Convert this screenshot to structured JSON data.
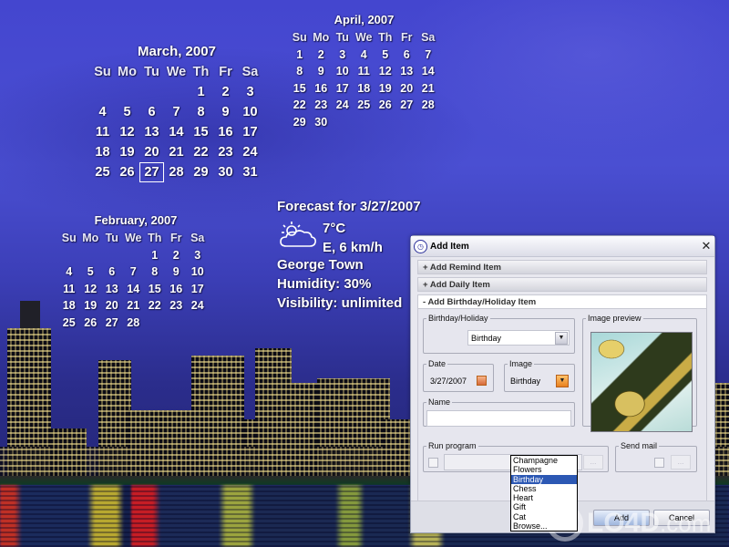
{
  "calendars": {
    "weekdays": [
      "Su",
      "Mo",
      "Tu",
      "We",
      "Th",
      "Fr",
      "Sa"
    ],
    "march": {
      "title": "March, 2007",
      "today": "27",
      "weeks": [
        [
          "",
          "",
          "",
          "",
          "1",
          "2",
          "3"
        ],
        [
          "4",
          "5",
          "6",
          "7",
          "8",
          "9",
          "10"
        ],
        [
          "11",
          "12",
          "13",
          "14",
          "15",
          "16",
          "17"
        ],
        [
          "18",
          "19",
          "20",
          "21",
          "22",
          "23",
          "24"
        ],
        [
          "25",
          "26",
          "27",
          "28",
          "29",
          "30",
          "31"
        ]
      ]
    },
    "april": {
      "title": "April, 2007",
      "weeks": [
        [
          "1",
          "2",
          "3",
          "4",
          "5",
          "6",
          "7"
        ],
        [
          "8",
          "9",
          "10",
          "11",
          "12",
          "13",
          "14"
        ],
        [
          "15",
          "16",
          "17",
          "18",
          "19",
          "20",
          "21"
        ],
        [
          "22",
          "23",
          "24",
          "25",
          "26",
          "27",
          "28"
        ],
        [
          "29",
          "30",
          "",
          "",
          "",
          "",
          ""
        ]
      ]
    },
    "february": {
      "title": "February, 2007",
      "weeks": [
        [
          "",
          "",
          "",
          "",
          "1",
          "2",
          "3"
        ],
        [
          "4",
          "5",
          "6",
          "7",
          "8",
          "9",
          "10"
        ],
        [
          "11",
          "12",
          "13",
          "14",
          "15",
          "16",
          "17"
        ],
        [
          "18",
          "19",
          "20",
          "21",
          "22",
          "23",
          "24"
        ],
        [
          "25",
          "26",
          "27",
          "28",
          "",
          "",
          ""
        ]
      ]
    }
  },
  "forecast": {
    "title": "Forecast for 3/27/2007",
    "icon": "partly-cloudy-icon",
    "temperature": "7°C",
    "wind": "E, 6 km/h",
    "location": "George Town",
    "humidity": "Humidity: 30%",
    "visibility": "Visibility: unlimited"
  },
  "dialog": {
    "title": "Add Item",
    "close_label": "✕",
    "sections": [
      {
        "label": "+ Add Remind Item",
        "expanded": false
      },
      {
        "label": "+ Add Daily Item",
        "expanded": false
      },
      {
        "label": "- Add Birthday/Holiday Item",
        "expanded": true
      }
    ],
    "birthday_holiday": {
      "legend": "Birthday/Holiday",
      "value": "Birthday"
    },
    "date": {
      "legend": "Date",
      "value": "3/27/2007"
    },
    "image": {
      "legend": "Image",
      "value": "Birthday",
      "options": [
        "Champagne",
        "Flowers",
        "Birthday",
        "Chess",
        "Heart",
        "Gift",
        "Cat",
        "Browse..."
      ],
      "selected": "Birthday"
    },
    "name": {
      "legend": "Name",
      "value": ""
    },
    "image_preview": {
      "legend": "Image preview"
    },
    "run_program": {
      "legend": "Run program",
      "checked": false,
      "value": "",
      "browse_label": "..."
    },
    "send_mail": {
      "legend": "Send mail",
      "checked": false,
      "browse_label": "..."
    },
    "buttons": {
      "add": "Add",
      "cancel": "Cancel"
    }
  },
  "watermark": {
    "brand": "LO4D",
    "suffix": ".com"
  }
}
